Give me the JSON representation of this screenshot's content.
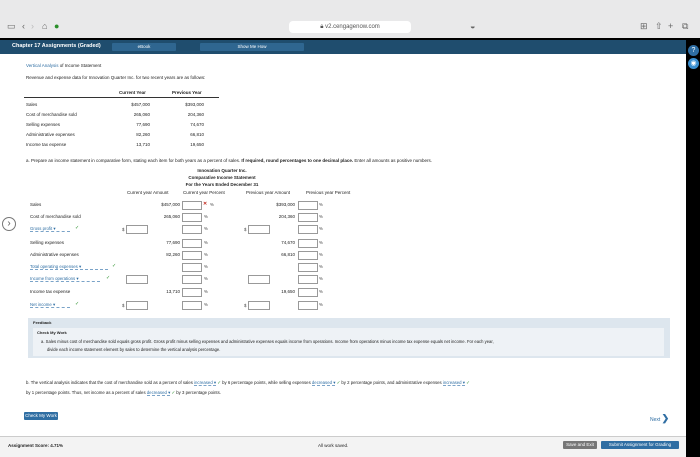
{
  "browser": {
    "url": "v2.cengagenow.com"
  },
  "header": {
    "title": "Chapter 17 Assignments (Graded)",
    "ebook": "eBook",
    "show_me": "Show Me How"
  },
  "page": {
    "section_title_link": "Vertical Analysis",
    "section_title_rest": " of Income Statement",
    "intro": "Revenue and expense data for Innovation Quarter Inc. for two recent years are as follows:",
    "data_table": {
      "headers": [
        "Current Year",
        "Previous Year"
      ],
      "rows": [
        {
          "label": "Sales",
          "cur": "$457,000",
          "prev": "$393,000"
        },
        {
          "label": "Cost of merchandise sold",
          "cur": "265,060",
          "prev": "204,360"
        },
        {
          "label": "Selling expenses",
          "cur": "77,690",
          "prev": "74,670"
        },
        {
          "label": "Administrative expenses",
          "cur": "82,260",
          "prev": "66,810"
        },
        {
          "label": "Income tax expense",
          "cur": "13,710",
          "prev": "19,650"
        }
      ]
    },
    "instruction_a": "a.  Prepare an income statement in comparative form, stating each item for both years as a percent of sales.",
    "instruction_bold": "If required, round percentages to one decimal place.",
    "instruction_rest": "Enter all amounts as positive numbers.",
    "statement": {
      "company": "Innovation Quarter Inc.",
      "title": "Comparative Income Statement",
      "period": "For the Years Ended December 31",
      "col_headers": [
        "Current year Amount",
        "Current year Percent",
        "Previous year Amount",
        "Previous year Percent"
      ],
      "pct_sign": "%",
      "rows": [
        {
          "label": "Sales",
          "cur": "$457,000",
          "prev": "$393,000"
        },
        {
          "label": "Cost of merchandise sold",
          "cur": "265,060",
          "prev": "204,360"
        },
        {
          "label": "Gross profit",
          "cur": "",
          "prev": ""
        },
        {
          "label": "Selling expenses",
          "cur": "77,690",
          "prev": "74,670"
        },
        {
          "label": "Administrative expenses",
          "cur": "82,260",
          "prev": "66,810"
        },
        {
          "label": "Total operating expenses",
          "cur": "",
          "prev": ""
        },
        {
          "label": "Income from operations",
          "cur": "",
          "prev": ""
        },
        {
          "label": "Income tax expense",
          "cur": "13,710",
          "prev": "19,650"
        },
        {
          "label": "Net income",
          "cur": "",
          "prev": ""
        }
      ]
    },
    "feedback": {
      "title": "Feedback",
      "check": "Check My Work",
      "text_a": "a.  Sales minus cost of merchandise sold equals gross profit. Gross profit minus selling expenses and administrative expenses equals income from operations. Income from operations minus income tax expense equals net income. For each year,",
      "text_b": "divide each income statement element by sales to determine the vertical analysis percentage."
    },
    "part_b": {
      "p1": "b.  The vertical analysis indicates that the cost of merchandise sold as a percent of sales",
      "sel1": "increased",
      "p2": "by 6 percentage points, while selling expenses",
      "sel2": "decreased",
      "p3": "by 2 percentage points, and administrative expenses",
      "sel3": "increased",
      "p4": "by 1 percentage points. Thus, net income as a percent of sales",
      "sel4": "decreased",
      "p5": "by 3 percentage points."
    },
    "check_button": "Check My Work",
    "next_button": "Next"
  },
  "footer": {
    "score": "Assignment Score:  4.71%",
    "saved": "All work saved.",
    "save_exit": "Save and Exit",
    "submit": "Submit Assignment for Grading"
  }
}
